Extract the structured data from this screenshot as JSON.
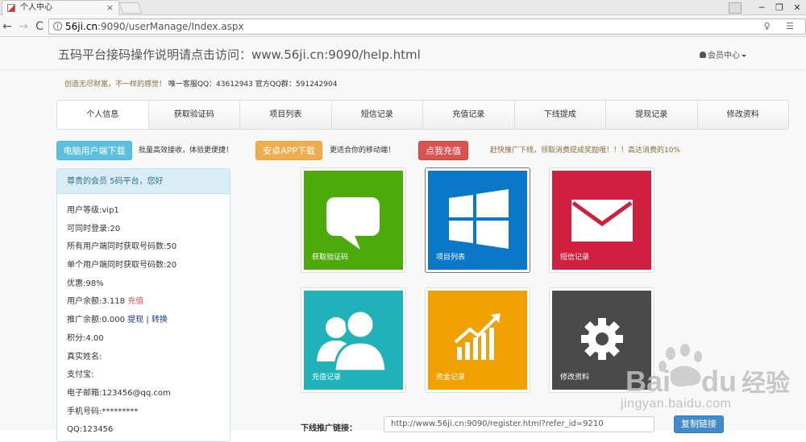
{
  "browser": {
    "tab_title": "个人中心",
    "tab_close": "×",
    "url_host": "56ji.cn",
    "url_rest": ":9090/userManage/Index.aspx",
    "win_min": "─",
    "win_max": "❐",
    "win_close": "✕",
    "back": "←",
    "forward": "→",
    "reload": "C",
    "addr_icons": "♀ ☰"
  },
  "header": {
    "site_title": "五码平台接码操作说明请点击访问：www.56ji.cn:9090/help.html",
    "member_menu": "会员中心"
  },
  "slogan": {
    "part1": "创造无尽财富，不一样的感觉！",
    "part2": "唯一客服QQ：43612943   官方QQ群：591242904"
  },
  "tabs": [
    "个人信息",
    "获取验证码",
    "项目列表",
    "短信记录",
    "充值记录",
    "下线提成",
    "提现记录",
    "修改资料"
  ],
  "actions": {
    "pc_download": "电脑用户端下载",
    "pc_note": "批量高效接收，体验更便捷！",
    "android_download": "安卓APP下载",
    "android_note": "更适合你的移动端！",
    "recharge": "点我充值",
    "recharge_note": "赶快推广下线，领取消费提成奖励哦！！！高达消费的10%"
  },
  "panel": {
    "heading": "尊贵的会员 5码平台，您好",
    "level": "用户等级:vip1",
    "concurrent": "可同时登录:20",
    "all_fetch": "所有用户端同时获取号码数:50",
    "single_fetch": "单个用户端同时获取号码数:20",
    "discount": "优惠:98%",
    "balance": "用户余额:3.118",
    "balance_link": "充值",
    "promo_balance": "推广余额:0.000",
    "withdraw_link": "提现",
    "sep": "|",
    "convert_link": "转换",
    "points": "积分:4.00",
    "real_name": "真实姓名:",
    "alipay": "支付宝:",
    "email": "电子邮箱:123456@qq.com",
    "phone": "手机号码:*********",
    "qq": "QQ:123456"
  },
  "tiles": [
    {
      "label": "获取验证码",
      "color": "#4cab0a"
    },
    {
      "label": "项目列表",
      "color": "#0a78c8"
    },
    {
      "label": "短信记录",
      "color": "#d0203f"
    },
    {
      "label": "充值记录",
      "color": "#20b2b8"
    },
    {
      "label": "资金记录",
      "color": "#f0a000"
    },
    {
      "label": "修改资料",
      "color": "#4a4a4a"
    }
  ],
  "promo": {
    "label": "下线推广链接：",
    "link": "http://www.56ji.cn:9090/register.html?refer_id=9210",
    "copy": "复制链接"
  },
  "watermark": {
    "brand": "Bai",
    "brand2": "du",
    "jingyan": "经验",
    "url": "jingyan.baidu.com"
  }
}
